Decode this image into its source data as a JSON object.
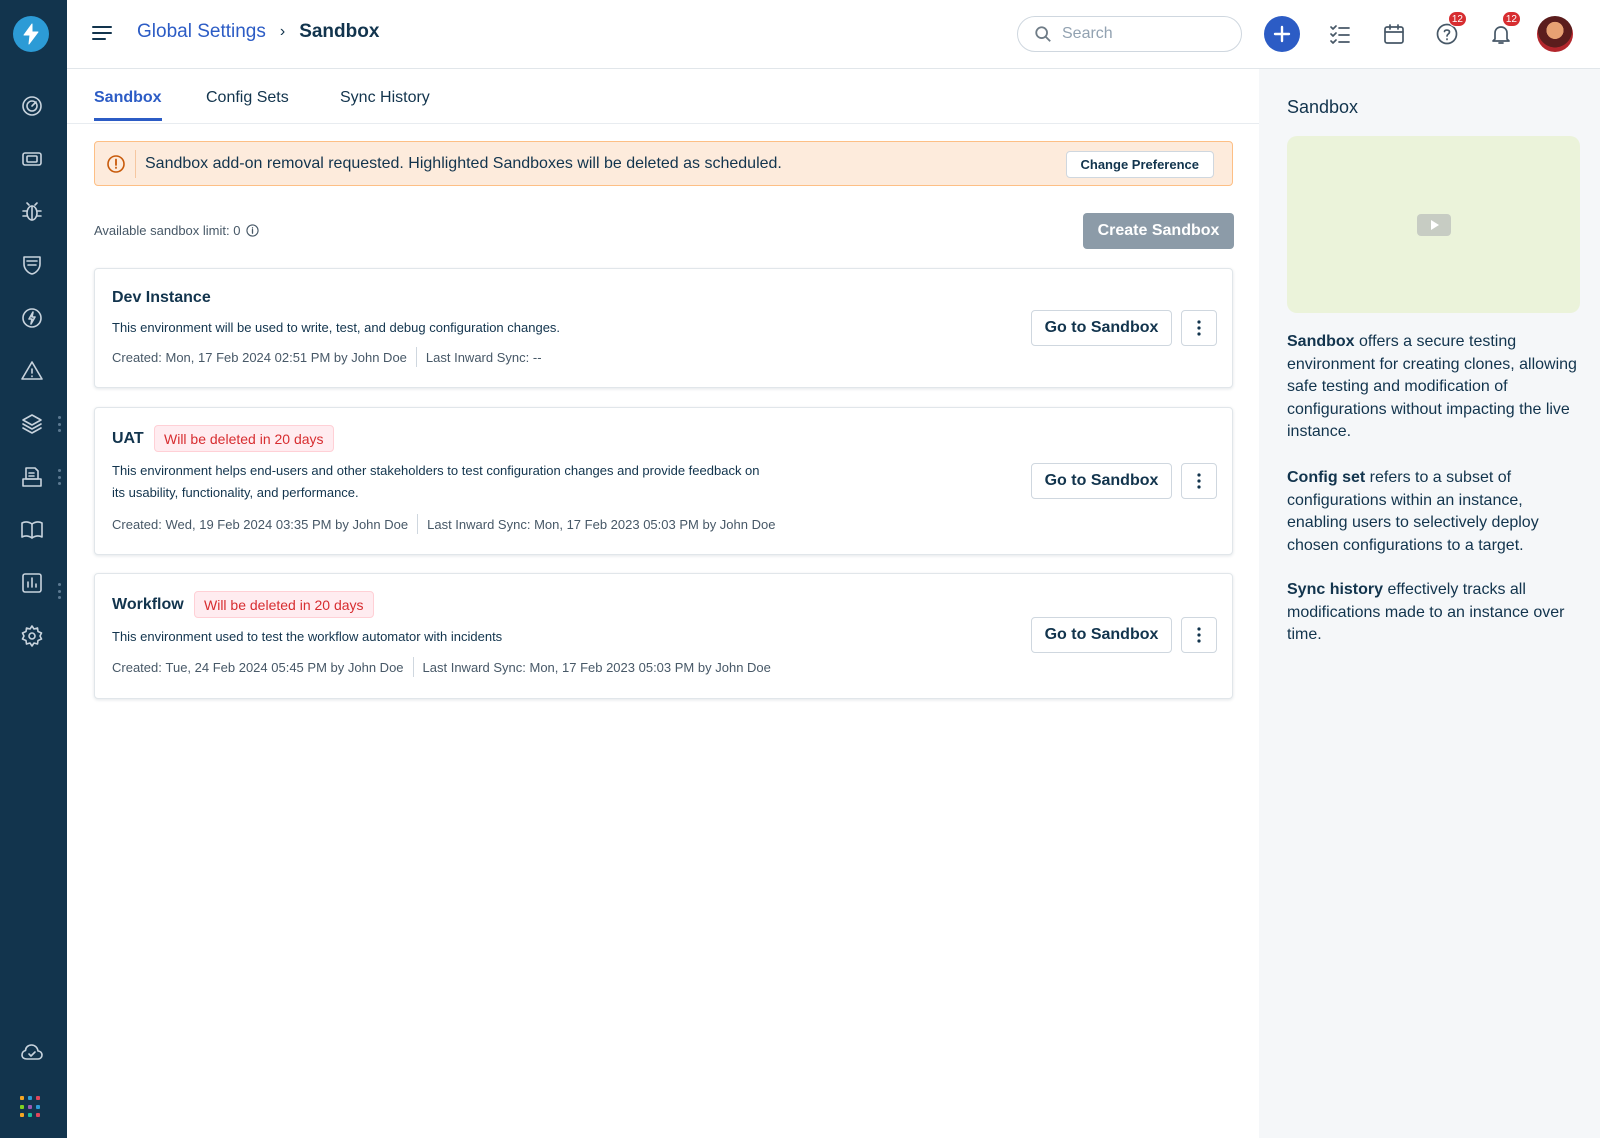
{
  "header": {
    "breadcrumb_parent": "Global Settings",
    "breadcrumb_current": "Sandbox",
    "search_placeholder": "Search",
    "help_badge": "12",
    "notifications_badge": "12"
  },
  "sidebar": {
    "items": [
      "dashboard-icon",
      "tickets-icon",
      "bug-icon",
      "shield-icon",
      "bolt-icon",
      "alert-icon",
      "layers-icon",
      "inbox-icon",
      "book-icon",
      "reports-icon",
      "settings-icon",
      "cloud-icon",
      "apps-icon"
    ]
  },
  "tabs": [
    {
      "label": "Sandbox",
      "active": true
    },
    {
      "label": "Config Sets",
      "active": false
    },
    {
      "label": "Sync History",
      "active": false
    }
  ],
  "alert": {
    "message": "Sandbox add-on removal requested. Highlighted Sandboxes will be deleted as scheduled.",
    "button": "Change Preference"
  },
  "limit_text": "Available sandbox limit: 0",
  "create_button": "Create Sandbox",
  "cards": [
    {
      "title": "Dev Instance",
      "badge": "",
      "description": "This environment will be used to write, test, and debug configuration changes.",
      "created_label": "Created:",
      "created_value": "Mon, 17 Feb 2024 02:51 PM",
      "created_by": "by John Doe",
      "sync_label": "Last Inward Sync:",
      "sync_value": "--",
      "sync_by": "",
      "button": "Go to Sandbox"
    },
    {
      "title": "UAT",
      "badge": "Will be deleted in 20 days",
      "description": "This environment helps end-users and other stakeholders to test configuration changes and provide feedback on its usability, functionality, and performance.",
      "created_label": "Created:",
      "created_value": "Wed, 19 Feb 2024 03:35 PM",
      "created_by": "by John Doe",
      "sync_label": "Last Inward Sync:",
      "sync_value": "Mon, 17 Feb 2023 05:03 PM",
      "sync_by": "by John Doe",
      "button": "Go to Sandbox"
    },
    {
      "title": "Workflow",
      "badge": "Will be deleted in 20 days",
      "description": "This environment used to test the workflow automator with incidents",
      "created_label": "Created:",
      "created_value": "Tue, 24 Feb 2024 05:45 PM",
      "created_by": "by John Doe",
      "sync_label": "Last Inward Sync:",
      "sync_value": "Mon, 17 Feb 2023 05:03 PM",
      "sync_by": "by John Doe",
      "button": "Go to Sandbox"
    }
  ],
  "right_panel": {
    "title": "Sandbox",
    "p1_bold": "Sandbox",
    "p1_text": " offers a secure testing environment for creating clones, allowing safe testing and modification of configurations without impacting the live instance.",
    "p2_bold": "Config set",
    "p2_text": " refers to a subset of configurations within an instance, enabling users to selectively deploy chosen configurations to a target.",
    "p3_bold": "Sync history",
    "p3_text": " effectively tracks all modifications made to an instance over time."
  },
  "colors": {
    "nav_bg": "#12344d",
    "accent": "#2c5cc5",
    "danger": "#d72d30",
    "alert_bg": "#fdebdc",
    "disabled_btn": "#8c9ba8"
  }
}
